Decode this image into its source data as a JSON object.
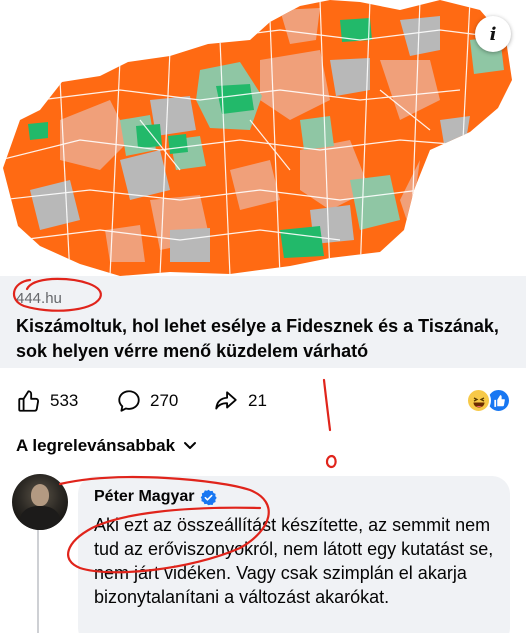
{
  "map": {
    "info_icon": "i",
    "colors": {
      "orange": "#ff6a13",
      "salmon": "#f0a07a",
      "gray": "#b8b8b8",
      "light_green": "#8fc6a4",
      "green": "#22b96a",
      "white": "#ffffff"
    }
  },
  "link_preview": {
    "domain": "444.hu",
    "headline": "Kiszámoltuk, hol lehet esélye a Fidesznek és a Tiszának, sok helyen vérre menő küzdelem várható"
  },
  "reactions": {
    "like_count": "533",
    "comment_count": "270",
    "share_count": "21",
    "emoji_icons": [
      "laughing-emoji-icon",
      "like-emoji-icon"
    ]
  },
  "sort": {
    "label": "A legrelevánsabbak"
  },
  "comment": {
    "author": "Péter Magyar",
    "verified_icon": "verified-badge-icon",
    "text": "Aki ezt az összeállítást készítette, az semmit nem tud az erőviszonyokról, nem látott egy kutatást se, nem járt vidéken. Vagy csak szimplán el akarja bizonytalanítani a változást akarókat."
  },
  "annotation": {
    "color": "#e0241b"
  }
}
